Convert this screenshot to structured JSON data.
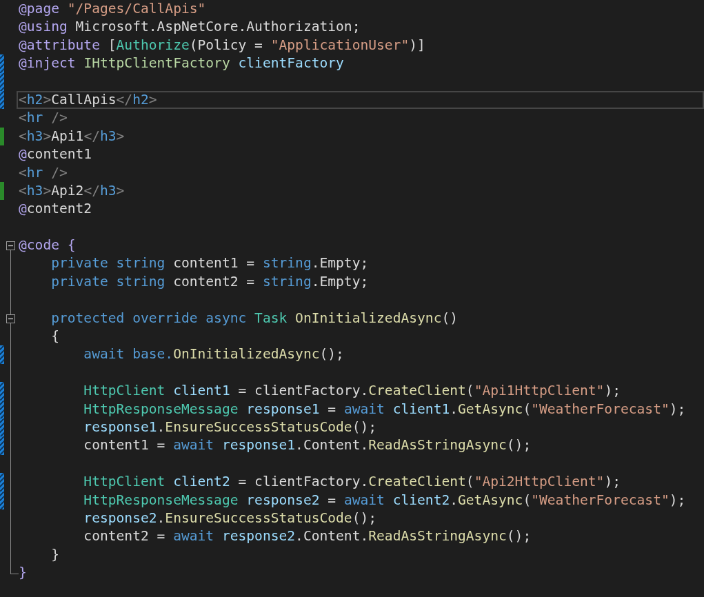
{
  "editor": {
    "lines": [
      {
        "tokens": [
          {
            "kind": "razor",
            "text": "@page "
          },
          {
            "kind": "str",
            "text": "\"/Pages/CallApis\""
          }
        ]
      },
      {
        "tokens": [
          {
            "kind": "razor",
            "text": "@using"
          },
          {
            "kind": "plain",
            "text": " Microsoft.AspNetCore.Authorization;"
          }
        ]
      },
      {
        "tokens": [
          {
            "kind": "razor",
            "text": "@attribute"
          },
          {
            "kind": "plain",
            "text": " ["
          },
          {
            "kind": "type",
            "text": "Authorize"
          },
          {
            "kind": "plain",
            "text": "(Policy = "
          },
          {
            "kind": "str",
            "text": "\"ApplicationUser\""
          },
          {
            "kind": "plain",
            "text": ")]"
          }
        ]
      },
      {
        "modified": true,
        "tokens": [
          {
            "kind": "razor",
            "text": "@inject "
          },
          {
            "kind": "iface",
            "text": "IHttpClientFactory "
          },
          {
            "kind": "var",
            "text": "clientFactory"
          }
        ]
      },
      {
        "modified": true
      },
      {
        "modified": true,
        "current": true,
        "tokens": [
          {
            "kind": "tagp",
            "text": "<"
          },
          {
            "kind": "tag",
            "text": "h2"
          },
          {
            "kind": "tagp",
            "text": ">"
          },
          {
            "kind": "plain",
            "text": "CallApis"
          },
          {
            "kind": "tagp",
            "text": "</"
          },
          {
            "kind": "tag",
            "text": "h2"
          },
          {
            "kind": "tagp",
            "text": ">"
          }
        ]
      },
      {
        "tokens": [
          {
            "kind": "tagp",
            "text": "<"
          },
          {
            "kind": "tag",
            "text": "hr"
          },
          {
            "kind": "tagp",
            "text": " />"
          }
        ]
      },
      {
        "added": true,
        "tokens": [
          {
            "kind": "tagp",
            "text": "<"
          },
          {
            "kind": "tag",
            "text": "h3"
          },
          {
            "kind": "tagp",
            "text": ">"
          },
          {
            "kind": "plain",
            "text": "Api1"
          },
          {
            "kind": "tagp",
            "text": "</"
          },
          {
            "kind": "tag",
            "text": "h3"
          },
          {
            "kind": "tagp",
            "text": ">"
          }
        ]
      },
      {
        "tokens": [
          {
            "kind": "razor",
            "text": "@"
          },
          {
            "kind": "plain",
            "text": "content1"
          }
        ]
      },
      {
        "tokens": [
          {
            "kind": "tagp",
            "text": "<"
          },
          {
            "kind": "tag",
            "text": "hr"
          },
          {
            "kind": "tagp",
            "text": " />"
          }
        ]
      },
      {
        "added": true,
        "tokens": [
          {
            "kind": "tagp",
            "text": "<"
          },
          {
            "kind": "tag",
            "text": "h3"
          },
          {
            "kind": "tagp",
            "text": ">"
          },
          {
            "kind": "plain",
            "text": "Api2"
          },
          {
            "kind": "tagp",
            "text": "</"
          },
          {
            "kind": "tag",
            "text": "h3"
          },
          {
            "kind": "tagp",
            "text": ">"
          }
        ]
      },
      {
        "tokens": [
          {
            "kind": "razor",
            "text": "@"
          },
          {
            "kind": "plain",
            "text": "content2"
          }
        ]
      },
      {
        "space_before": true,
        "expanded": true,
        "tokens": [
          {
            "kind": "razor",
            "text": "@code {"
          }
        ],
        "children": [
          {
            "tokens": [
              {
                "kind": "kw",
                "text": "    private string "
              },
              {
                "kind": "plain",
                "text": "content1 = "
              },
              {
                "kind": "kw",
                "text": "string"
              },
              {
                "kind": "plain",
                "text": ".Empty;"
              }
            ]
          },
          {
            "tokens": [
              {
                "kind": "kw",
                "text": "    private string "
              },
              {
                "kind": "plain",
                "text": "content2 = "
              },
              {
                "kind": "kw",
                "text": "string"
              },
              {
                "kind": "plain",
                "text": ".Empty;"
              }
            ]
          },
          {
            "space_before": true,
            "expanded": true,
            "tokens": [
              {
                "kind": "kw",
                "text": "    protected override async "
              },
              {
                "kind": "type",
                "text": "Task "
              },
              {
                "kind": "method",
                "text": "OnInitializedAsync"
              },
              {
                "kind": "plain",
                "text": "()"
              }
            ],
            "children": [
              {
                "tokens": [
                  {
                    "kind": "plain",
                    "text": "    {"
                  }
                ]
              },
              {
                "modified": true,
                "tokens": [
                  {
                    "kind": "kw",
                    "text": "        await base."
                  },
                  {
                    "kind": "method",
                    "text": "OnInitializedAsync"
                  },
                  {
                    "kind": "plain",
                    "text": "();"
                  }
                ]
              },
              {
                "space_before": true,
                "modified": true,
                "tokens": [
                  {
                    "kind": "type",
                    "text": "        HttpClient "
                  },
                  {
                    "kind": "var",
                    "text": "client1"
                  },
                  {
                    "kind": "plain",
                    "text": " = clientFactory."
                  },
                  {
                    "kind": "method",
                    "text": "CreateClient"
                  },
                  {
                    "kind": "plain",
                    "text": "("
                  },
                  {
                    "kind": "str",
                    "text": "\"Api1HttpClient\""
                  },
                  {
                    "kind": "plain",
                    "text": ");"
                  }
                ]
              },
              {
                "modified": true,
                "tokens": [
                  {
                    "kind": "type",
                    "text": "        HttpResponseMessage "
                  },
                  {
                    "kind": "var",
                    "text": "response1"
                  },
                  {
                    "kind": "plain",
                    "text": " = "
                  },
                  {
                    "kind": "kw",
                    "text": "await "
                  },
                  {
                    "kind": "var",
                    "text": "client1"
                  },
                  {
                    "kind": "plain",
                    "text": "."
                  },
                  {
                    "kind": "method",
                    "text": "GetAsync"
                  },
                  {
                    "kind": "plain",
                    "text": "("
                  },
                  {
                    "kind": "str",
                    "text": "\"WeatherForecast\""
                  },
                  {
                    "kind": "plain",
                    "text": ");"
                  }
                ]
              },
              {
                "modified": true,
                "tokens": [
                  {
                    "kind": "var",
                    "text": "        response1"
                  },
                  {
                    "kind": "plain",
                    "text": "."
                  },
                  {
                    "kind": "method",
                    "text": "EnsureSuccessStatusCode"
                  },
                  {
                    "kind": "plain",
                    "text": "();"
                  }
                ]
              },
              {
                "modified": true,
                "tokens": [
                  {
                    "kind": "plain",
                    "text": "        content1 = "
                  },
                  {
                    "kind": "kw",
                    "text": "await "
                  },
                  {
                    "kind": "var",
                    "text": "response1"
                  },
                  {
                    "kind": "plain",
                    "text": ".Content."
                  },
                  {
                    "kind": "method",
                    "text": "ReadAsStringAsync"
                  },
                  {
                    "kind": "plain",
                    "text": "();"
                  }
                ]
              },
              {
                "space_before": true,
                "modified": true,
                "tokens": [
                  {
                    "kind": "type",
                    "text": "        HttpClient "
                  },
                  {
                    "kind": "var",
                    "text": "client2"
                  },
                  {
                    "kind": "plain",
                    "text": " = clientFactory."
                  },
                  {
                    "kind": "method",
                    "text": "CreateClient"
                  },
                  {
                    "kind": "plain",
                    "text": "("
                  },
                  {
                    "kind": "str",
                    "text": "\"Api2HttpClient\""
                  },
                  {
                    "kind": "plain",
                    "text": ");"
                  }
                ]
              },
              {
                "modified": true,
                "tokens": [
                  {
                    "kind": "type",
                    "text": "        HttpResponseMessage "
                  },
                  {
                    "kind": "var",
                    "text": "response2"
                  },
                  {
                    "kind": "plain",
                    "text": " = "
                  },
                  {
                    "kind": "kw",
                    "text": "await "
                  },
                  {
                    "kind": "var",
                    "text": "client2"
                  },
                  {
                    "kind": "plain",
                    "text": "."
                  },
                  {
                    "kind": "method",
                    "text": "GetAsync"
                  },
                  {
                    "kind": "plain",
                    "text": "("
                  },
                  {
                    "kind": "str",
                    "text": "\"WeatherForecast\""
                  },
                  {
                    "kind": "plain",
                    "text": ");"
                  }
                ]
              },
              {
                "tokens": [
                  {
                    "kind": "var",
                    "text": "        response2"
                  },
                  {
                    "kind": "plain",
                    "text": "."
                  },
                  {
                    "kind": "method",
                    "text": "EnsureSuccessStatusCode"
                  },
                  {
                    "kind": "plain",
                    "text": "();"
                  }
                ]
              },
              {
                "tokens": [
                  {
                    "kind": "plain",
                    "text": "        content2 = "
                  },
                  {
                    "kind": "kw",
                    "text": "await "
                  },
                  {
                    "kind": "var",
                    "text": "response2"
                  },
                  {
                    "kind": "plain",
                    "text": ".Content."
                  },
                  {
                    "kind": "method",
                    "text": "ReadAsStringAsync"
                  },
                  {
                    "kind": "plain",
                    "text": "();"
                  }
                ]
              },
              {
                "tokens": [
                  {
                    "kind": "plain",
                    "text": "    }"
                  }
                ]
              }
            ]
          },
          {
            "tokens": [
              {
                "kind": "razor",
                "text": "}"
              }
            ]
          }
        ]
      }
    ]
  }
}
